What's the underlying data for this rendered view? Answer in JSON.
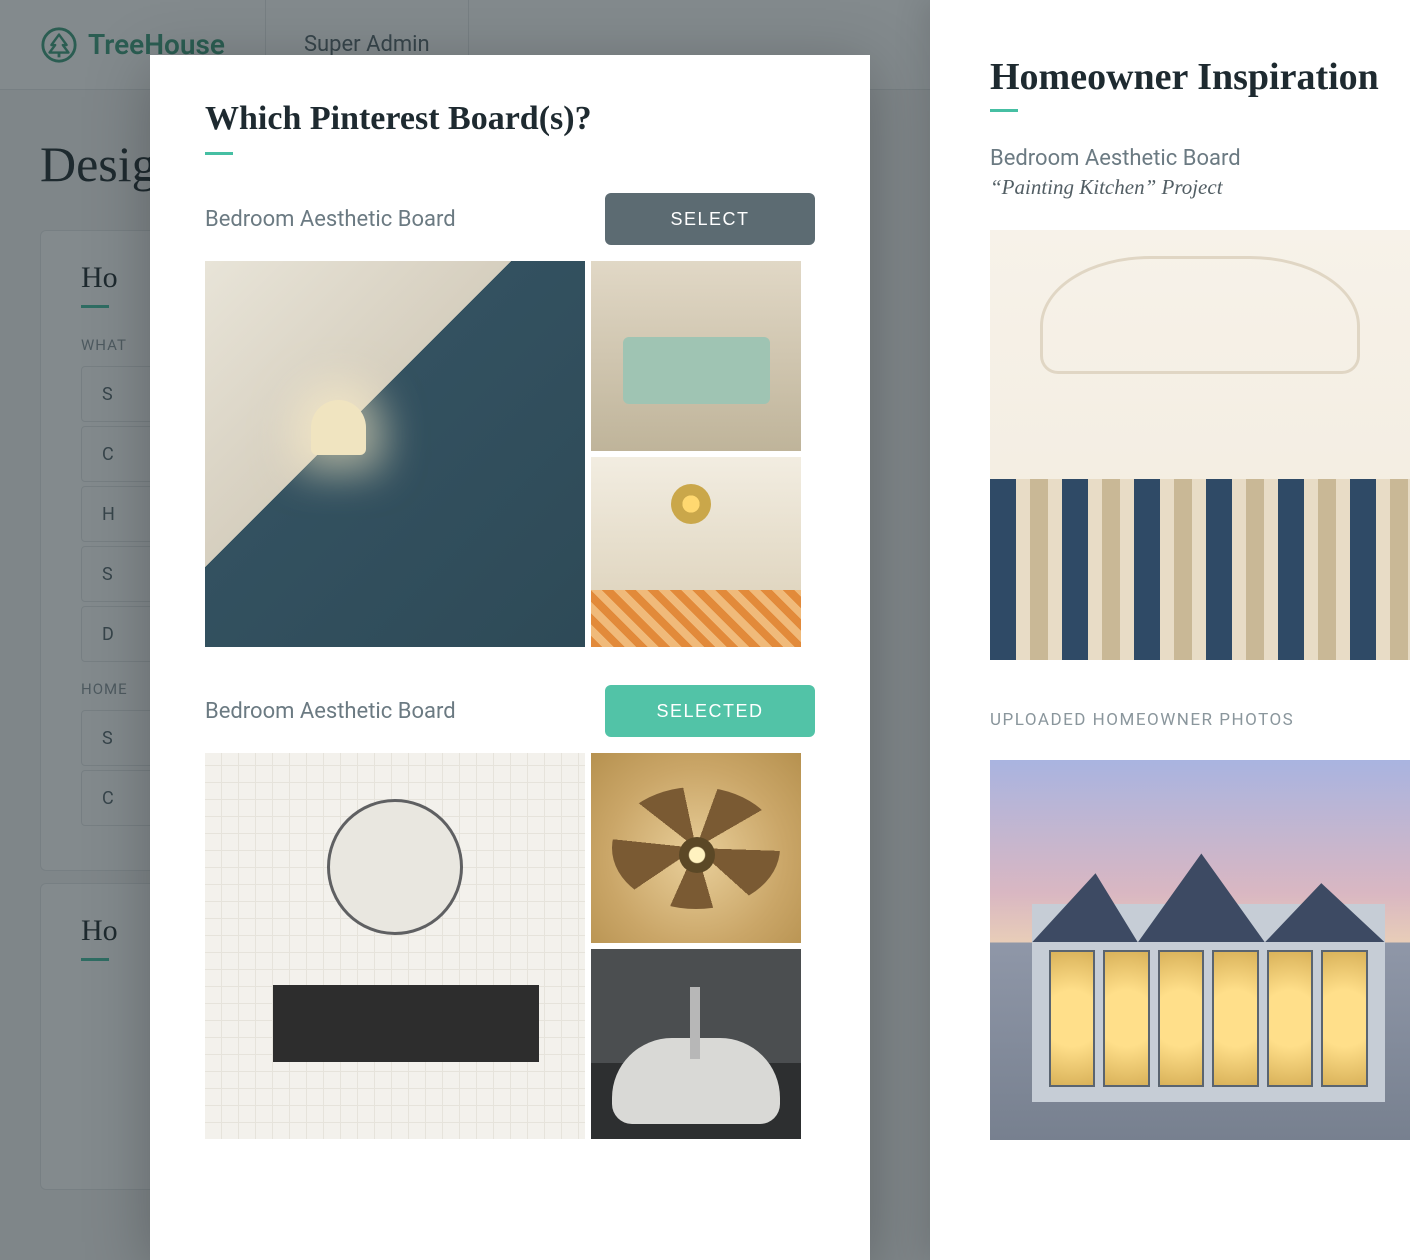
{
  "background": {
    "brand": "TreeHouse",
    "topbar_tab": "Super Admin",
    "page_title_prefix": "Desig",
    "card1_title_prefix": "Ho",
    "section_label_prefix": "WHAT",
    "section2_label_prefix": "HOME",
    "card2_title_prefix": "Ho",
    "field_initials": [
      "S",
      "C",
      "H",
      "S",
      "D",
      "S",
      "C"
    ]
  },
  "modal": {
    "title": "Which Pinterest Board(s)?",
    "boards": [
      {
        "name": "Bedroom Aesthetic Board",
        "button": "SELECT",
        "state": "select"
      },
      {
        "name": "Bedroom Aesthetic Board",
        "button": "SELECTED",
        "state": "selected"
      }
    ]
  },
  "right_panel": {
    "title": "Homeowner Inspiration",
    "board_name": "Bedroom Aesthetic Board",
    "project_line": "“Painting Kitchen” Project",
    "uploaded_label": "UPLOADED HOMEOWNER PHOTOS"
  }
}
